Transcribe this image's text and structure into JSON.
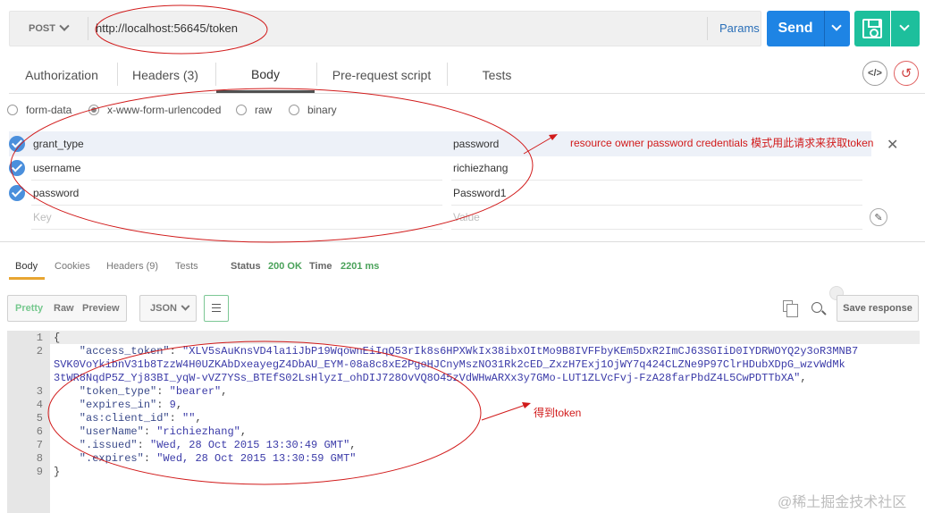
{
  "request": {
    "method": "POST",
    "url": "http://localhost:56645/token",
    "params_label": "Params",
    "send_label": "Send"
  },
  "request_tabs": [
    {
      "label": "Authorization"
    },
    {
      "label": "Headers (3)"
    },
    {
      "label": "Body"
    },
    {
      "label": "Pre-request script"
    },
    {
      "label": "Tests"
    }
  ],
  "body_types": [
    {
      "label": "form-data"
    },
    {
      "label": "x-www-form-urlencoded"
    },
    {
      "label": "raw"
    },
    {
      "label": "binary"
    }
  ],
  "form_rows": [
    {
      "key": "grant_type",
      "value": "password"
    },
    {
      "key": "username",
      "value": "richiezhang"
    },
    {
      "key": "password",
      "value": "Password1"
    }
  ],
  "new_row": {
    "key_placeholder": "Key",
    "value_placeholder": "Value"
  },
  "response_tabs": [
    {
      "label": "Body"
    },
    {
      "label": "Cookies"
    },
    {
      "label": "Headers (9)"
    },
    {
      "label": "Tests"
    }
  ],
  "response_status": {
    "status_label": "Status",
    "status_value": "200 OK",
    "time_label": "Time",
    "time_value": "2201 ms"
  },
  "view_modes": [
    {
      "label": "Pretty"
    },
    {
      "label": "Raw"
    },
    {
      "label": "Preview"
    }
  ],
  "format_label": "JSON",
  "save_response_label": "Save response",
  "line_numbers": [
    "1",
    "2",
    "3",
    "4",
    "5",
    "6",
    "7",
    "8",
    "9"
  ],
  "code": {
    "l1": "{",
    "l2_key": "    \"access_token\"",
    "l2_val": "\"XLV5sAuKnsVD4la1iJbP19WqownEiIqQ53rIk8s6HPXWkIx38ibxOItMo9B8IVFFbyKEm5DxR2ImCJ63SGIiD0IYDRWOYQ2y3oR3MNB7",
    "l2b": "SVK0VoYkibnV31b8TzzW4H0UZKAbDxeayegZ4DbAU_EYM-08a8c8xE2PgeHJCnyMszNO31Rk2cED_ZxzH7Exj1OjWY7q424CLZNe9P97ClrHDubXDpG_wzvWdMk",
    "l2c": "3tWR8NqdP5Z_Yj83BI_yqW-vVZ7YSs_BTEfS02LsHlyzI_ohDIJ728OvVQ8O45zVdWHwARXx3y7GMo-LUT1ZLVcFvj-FzA28farPbdZ4L5CwPDTTbXA\"",
    "l3_key": "    \"token_type\"",
    "l3_val": "\"bearer\"",
    "l4_key": "    \"expires_in\"",
    "l4_val": "9",
    "l5_key": "    \"as:client_id\"",
    "l5_val": "\"\"",
    "l6_key": "    \"userName\"",
    "l6_val": "\"richiezhang\"",
    "l7_key": "    \".issued\"",
    "l7_val": "\"Wed, 28 Oct 2015 13:30:49 GMT\"",
    "l8_key": "    \".expires\"",
    "l8_val": "\"Wed, 28 Oct 2015 13:30:59 GMT\"",
    "l9": "}"
  },
  "annotations": {
    "request_note": "resource owner password credentials 模式用此请求来获取token",
    "response_note": "得到token"
  },
  "watermark": "@稀土掘金技术社区",
  "colors": {
    "send": "#1e84e4",
    "save": "#1dbf9c",
    "status_ok": "#4aa25a",
    "annotation": "#d11a1a"
  }
}
